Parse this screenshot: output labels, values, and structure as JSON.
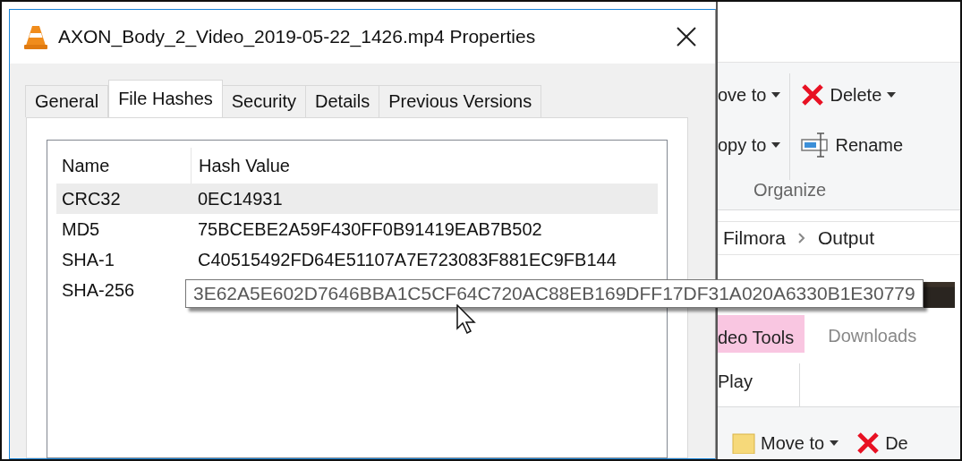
{
  "dialog": {
    "title": "AXON_Body_2_Video_2019-05-22_1426.mp4 Properties",
    "tabs": [
      {
        "label": "General",
        "selected": false
      },
      {
        "label": "File Hashes",
        "selected": true
      },
      {
        "label": "Security",
        "selected": false
      },
      {
        "label": "Details",
        "selected": false
      },
      {
        "label": "Previous Versions",
        "selected": false
      }
    ],
    "list": {
      "columns": [
        "Name",
        "Hash Value"
      ],
      "rows": [
        {
          "name": "CRC32",
          "value": "0EC14931",
          "selected": true
        },
        {
          "name": "MD5",
          "value": "75BCEBE2A59F430FF0B91419EAB7B502",
          "selected": false
        },
        {
          "name": "SHA-1",
          "value": "C40515492FD64E51107A7E723083F881EC9FB144",
          "selected": false
        },
        {
          "name": "SHA-256",
          "selected": false
        }
      ]
    },
    "tooltip": "3E62A5E602D7646BBA1C5CF64C720AC88EB169DFF17DF31A020A6330B1E30779"
  },
  "explorer": {
    "ribbon": {
      "columns": [
        [
          {
            "label": "ove to",
            "kind": "text",
            "dropdown": true
          },
          {
            "label": "opy to",
            "kind": "text",
            "dropdown": true
          }
        ],
        [
          {
            "label": "Delete",
            "kind": "delete",
            "dropdown": true
          },
          {
            "label": "Rename",
            "kind": "rename",
            "dropdown": false
          }
        ]
      ],
      "group": "Organize"
    },
    "breadcrumb": [
      "Filmora",
      "Output"
    ],
    "context_tab": "deo Tools",
    "title": "Downloads",
    "ribbon_tabs": [
      "Play"
    ],
    "bottom_ribbon": [
      {
        "label": "Move to",
        "kind": "move",
        "dropdown": true
      },
      {
        "label": "De",
        "kind": "delete",
        "dropdown": false
      }
    ]
  }
}
